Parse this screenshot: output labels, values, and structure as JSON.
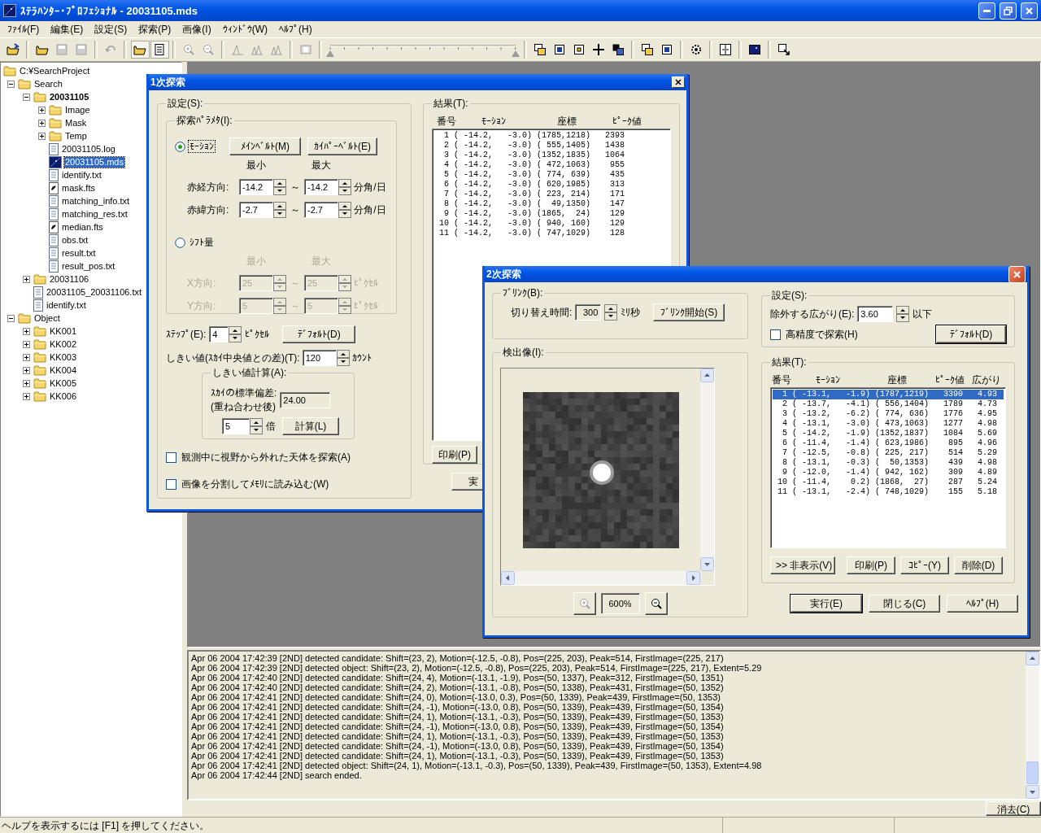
{
  "window": {
    "title": "ｽﾃﾗﾊﾝﾀｰ･ﾌﾟﾛﾌｪｼｮﾅﾙ - 20031105.mds"
  },
  "menu": [
    "ﾌｧｲﾙ(F)",
    "編集(E)",
    "設定(S)",
    "探索(P)",
    "画像(I)",
    "ｳｨﾝﾄﾞｳ(W)",
    "ﾍﾙﾌﾟ(H)"
  ],
  "toolbar": [
    {
      "kind": "open-project",
      "disabled": false,
      "pressed": false
    },
    {
      "kind": "separator"
    },
    {
      "kind": "open",
      "disabled": false,
      "pressed": false
    },
    {
      "kind": "save",
      "disabled": true,
      "pressed": false
    },
    {
      "kind": "save-all",
      "disabled": true,
      "pressed": false
    },
    {
      "kind": "separator"
    },
    {
      "kind": "undo",
      "disabled": true,
      "pressed": false
    },
    {
      "kind": "separator"
    },
    {
      "kind": "folder-view",
      "disabled": false,
      "pressed": true
    },
    {
      "kind": "document-view",
      "disabled": false,
      "pressed": true
    },
    {
      "kind": "separator"
    },
    {
      "kind": "zoom-in",
      "disabled": true,
      "pressed": false
    },
    {
      "kind": "zoom-out",
      "disabled": true,
      "pressed": false
    },
    {
      "kind": "separator"
    },
    {
      "kind": "peak",
      "disabled": true,
      "pressed": false
    },
    {
      "kind": "multi-peak",
      "disabled": true,
      "pressed": false
    },
    {
      "kind": "multi-peak",
      "disabled": true,
      "pressed": false
    },
    {
      "kind": "separator"
    },
    {
      "kind": "film",
      "disabled": true,
      "pressed": false
    },
    {
      "kind": "separator"
    },
    {
      "kind": "slider",
      "thumbs": [
        {
          "level": 0
        },
        {
          "level": 1
        }
      ]
    },
    {
      "kind": "separator"
    },
    {
      "kind": "windows",
      "disabled": false,
      "pressed": false
    },
    {
      "kind": "frame",
      "disabled": false,
      "pressed": false
    },
    {
      "kind": "target",
      "disabled": false,
      "pressed": false
    },
    {
      "kind": "crosshair",
      "disabled": false,
      "pressed": false
    },
    {
      "kind": "overlay",
      "disabled": false,
      "pressed": false
    },
    {
      "kind": "separator"
    },
    {
      "kind": "windows",
      "disabled": false,
      "pressed": false
    },
    {
      "kind": "frame",
      "disabled": false,
      "pressed": false
    },
    {
      "kind": "separator"
    },
    {
      "kind": "gear",
      "disabled": false,
      "pressed": false
    },
    {
      "kind": "separator"
    },
    {
      "kind": "split",
      "disabled": false,
      "pressed": false
    },
    {
      "kind": "separator"
    },
    {
      "kind": "picture",
      "disabled": false,
      "pressed": false
    },
    {
      "kind": "separator"
    },
    {
      "kind": "export",
      "disabled": false,
      "pressed": false
    }
  ],
  "tree": {
    "label": "C:¥SearchProject",
    "kind": "folder",
    "selected": false,
    "current": false,
    "children": [
      {
        "label": "Search",
        "kind": "folder",
        "expanded": true,
        "selected": false,
        "current": false,
        "children": [
          {
            "label": "20031105",
            "kind": "folder",
            "expanded": true,
            "selected": false,
            "current": true,
            "children": [
              {
                "label": "Image",
                "kind": "folder",
                "expanded": false,
                "selected": false,
                "current": false
              },
              {
                "label": "Mask",
                "kind": "folder",
                "expanded": false,
                "selected": false,
                "current": false
              },
              {
                "label": "Temp",
                "kind": "folder",
                "expanded": false,
                "selected": false,
                "current": false
              },
              {
                "label": "20031105.log",
                "kind": "text",
                "selected": false,
                "current": false
              },
              {
                "label": "20031105.mds",
                "kind": "project",
                "selected": true,
                "current": false
              },
              {
                "label": "identify.txt",
                "kind": "text",
                "selected": false,
                "current": false
              },
              {
                "label": "mask.fts",
                "kind": "image",
                "selected": false,
                "current": false
              },
              {
                "label": "matching_info.txt",
                "kind": "text",
                "selected": false,
                "current": false
              },
              {
                "label": "matching_res.txt",
                "kind": "text",
                "selected": false,
                "current": false
              },
              {
                "label": "median.fts",
                "kind": "image",
                "selected": false,
                "current": false
              },
              {
                "label": "obs.txt",
                "kind": "text",
                "selected": false,
                "current": false
              },
              {
                "label": "result.txt",
                "kind": "text",
                "selected": false,
                "current": false
              },
              {
                "label": "result_pos.txt",
                "kind": "text",
                "selected": false,
                "current": false
              }
            ]
          },
          {
            "label": "20031106",
            "kind": "folder",
            "expanded": false,
            "selected": false,
            "current": false
          },
          {
            "label": "20031105_20031106.txt",
            "kind": "text",
            "selected": false,
            "current": false
          },
          {
            "label": "identify.txt",
            "kind": "text",
            "selected": false,
            "current": false
          }
        ]
      },
      {
        "label": "Object",
        "kind": "folder",
        "expanded": true,
        "selected": false,
        "current": false,
        "children": [
          {
            "label": "KK001",
            "kind": "folder",
            "expanded": false,
            "selected": false,
            "current": false
          },
          {
            "label": "KK002",
            "kind": "folder",
            "expanded": false,
            "selected": false,
            "current": false
          },
          {
            "label": "KK003",
            "kind": "folder",
            "expanded": false,
            "selected": false,
            "current": false
          },
          {
            "label": "KK004",
            "kind": "folder",
            "expanded": false,
            "selected": false,
            "current": false
          },
          {
            "label": "KK005",
            "kind": "folder",
            "expanded": false,
            "selected": false,
            "current": false
          },
          {
            "label": "KK006",
            "kind": "folder",
            "expanded": false,
            "selected": false,
            "current": false
          }
        ]
      }
    ]
  },
  "search1": {
    "title": "1次探索",
    "settings_label": "設定(S):",
    "params_label": "探索ﾊﾟﾗﾒﾀ(I):",
    "motion": {
      "label": "ﾓｰｼｮﾝ",
      "selected": true,
      "buttons": [
        "ﾒｲﾝﾍﾞﾙﾄ(M)",
        "ｶｲﾊﾟｰﾍﾞﾙﾄ(E)"
      ],
      "min_label": "最小",
      "max_label": "最大",
      "rows": [
        {
          "label": "赤経方向:",
          "min": "-14.2",
          "sep": "～",
          "max": "-14.2",
          "unit": "分角/日"
        },
        {
          "label": "赤緯方向:",
          "min": "-2.7",
          "sep": "～",
          "max": "-2.7",
          "unit": "分角/日"
        }
      ]
    },
    "shift": {
      "label": "ｼﾌﾄ量",
      "selected": false,
      "min_label": "最小",
      "max_label": "最大",
      "rows": [
        {
          "label": "X方向:",
          "min": "25",
          "sep": "～",
          "max": "25",
          "unit": "ﾋﾟｸｾﾙ"
        },
        {
          "label": "Y方向:",
          "min": "5",
          "sep": "～",
          "max": "5",
          "unit": "ﾋﾟｸｾﾙ"
        }
      ]
    },
    "step": {
      "label": "ｽﾃｯﾌﾟ(E):",
      "value": "4",
      "unit": "ﾋﾟｸｾﾙ",
      "button": "ﾃﾞﾌｫﾙﾄ(D)"
    },
    "threshold": {
      "label": "しきい値(ｽｶｲ中央値との差)(T):",
      "value": "120",
      "unit": "ｶｳﾝﾄ"
    },
    "calc": {
      "label": "しきい値計算(A):",
      "sigma_label": "ｽｶｲの標準偏差:",
      "sigma_note": "(重ね合わせ後)",
      "sigma": "24.00",
      "factor": "5",
      "factor_unit": "倍",
      "button": "計算(L)"
    },
    "options": [
      {
        "label": "観測中に視野から外れた天体を探索(A)",
        "checked": false
      },
      {
        "label": "画像を分割してﾒﾓﾘに読み込む(W)",
        "checked": false
      }
    ],
    "results": {
      "label": "結果(T):",
      "columns": [
        "番号",
        "ﾓｰｼｮﾝ",
        "座標",
        "ﾋﾟｰｸ値"
      ],
      "rows": [
        "  1 ( -14.2,   -3.0) (1785,1218)   2393",
        "  2 ( -14.2,   -3.0) ( 555,1405)   1438",
        "  3 ( -14.2,   -3.0) (1352,1835)   1064",
        "  4 ( -14.2,   -3.0) ( 472,1063)    955",
        "  5 ( -14.2,   -3.0) ( 774, 639)    435",
        "  6 ( -14.2,   -3.0) ( 620,1985)    313",
        "  7 ( -14.2,   -3.0) ( 223, 214)    171",
        "  8 ( -14.2,   -3.0) (  49,1350)    147",
        "  9 ( -14.2,   -3.0) (1865,  24)    129",
        " 10 ( -14.2,   -3.0) ( 940, 160)    129",
        " 11 ( -14.2,   -3.0) ( 747,1029)    128"
      ]
    },
    "buttons": [
      "印刷(P)",
      "実"
    ]
  },
  "search2": {
    "title": "2次探索",
    "blink": {
      "label": "ﾌﾞﾘﾝｸ(B):",
      "time_label": "切り替え時間:",
      "time": "300",
      "unit": "ﾐﾘ秒",
      "button": "ﾌﾞﾘﾝｸ開始(S)"
    },
    "image": {
      "label": "検出像(I):",
      "zoom": "600%",
      "zoom_in": {
        "disabled": true
      },
      "zoom_out": {
        "disabled": false
      }
    },
    "settings": {
      "label": "設定(S):",
      "extent_label": "除外する広がり(E):",
      "extent": "3.60",
      "extent_unit": "以下",
      "precise": {
        "label": "高精度で探索(H)",
        "checked": false
      },
      "button": "ﾃﾞﾌｫﾙﾄ(D)"
    },
    "results": {
      "label": "結果(T):",
      "columns": [
        "番号",
        "ﾓｰｼｮﾝ",
        "座標",
        "ﾋﾟｰｸ値",
        "広がり"
      ],
      "rows": [
        {
          "text": "  1 ( -13.1,   -1.9) (1787,1219)   3390   4.93",
          "selected": true
        },
        {
          "text": "  2 ( -13.7,   -4.1) ( 556,1404)   1789   4.73",
          "selected": false
        },
        {
          "text": "  3 ( -13.2,   -6.2) ( 774, 636)   1776   4.95",
          "selected": false
        },
        {
          "text": "  4 ( -13.1,   -3.0) ( 473,1063)   1277   4.98",
          "selected": false
        },
        {
          "text": "  5 ( -14.2,   -1.9) (1352,1837)   1084   5.69",
          "selected": false
        },
        {
          "text": "  6 ( -11.4,   -1.4) ( 623,1986)    895   4.96",
          "selected": false
        },
        {
          "text": "  7 ( -12.5,   -0.8) ( 225, 217)    514   5.29",
          "selected": false
        },
        {
          "text": "  8 ( -13.1,   -0.3) (  50,1353)    439   4.98",
          "selected": false
        },
        {
          "text": "  9 ( -12.0,   -1.4) ( 942, 162)    309   4.89",
          "selected": false
        },
        {
          "text": " 10 ( -11.4,    0.2) (1868,  27)    287   5.24",
          "selected": false
        },
        {
          "text": " 11 ( -13.1,   -2.4) ( 748,1029)    155   5.18",
          "selected": false
        }
      ],
      "buttons": [
        ">> 非表示(V)",
        "印刷(P)",
        "ｺﾋﾟｰ(Y)",
        "削除(D)"
      ]
    },
    "buttons": [
      "実行(E)",
      "閉じる(C)",
      "ﾍﾙﾌﾟ(H)"
    ]
  },
  "log": {
    "lines": [
      "Apr 06 2004 17:42:39 [2ND] detected candidate: Shift=(23, 2), Motion=(-12.5, -0.8), Pos=(225, 203), Peak=514, FirstImage=(225, 217)",
      "Apr 06 2004 17:42:39 [2ND] detected object: Shift=(23, 2), Motion=(-12.5, -0.8), Pos=(225, 203), Peak=514, FirstImage=(225, 217), Extent=5.29",
      "Apr 06 2004 17:42:40 [2ND] detected candidate: Shift=(24, 4), Motion=(-13.1, -1.9), Pos=(50, 1337), Peak=312, FirstImage=(50, 1351)",
      "Apr 06 2004 17:42:40 [2ND] detected candidate: Shift=(24, 2), Motion=(-13.1, -0.8), Pos=(50, 1338), Peak=431, FirstImage=(50, 1352)",
      "Apr 06 2004 17:42:41 [2ND] detected candidate: Shift=(24, 0), Motion=(-13.0, 0.3), Pos=(50, 1339), Peak=439, FirstImage=(50, 1353)",
      "Apr 06 2004 17:42:41 [2ND] detected candidate: Shift=(24, -1), Motion=(-13.0, 0.8), Pos=(50, 1339), Peak=439, FirstImage=(50, 1354)",
      "Apr 06 2004 17:42:41 [2ND] detected candidate: Shift=(24, 1), Motion=(-13.1, -0.3), Pos=(50, 1339), Peak=439, FirstImage=(50, 1353)",
      "Apr 06 2004 17:42:41 [2ND] detected candidate: Shift=(24, -1), Motion=(-13.0, 0.8), Pos=(50, 1339), Peak=439, FirstImage=(50, 1354)",
      "Apr 06 2004 17:42:41 [2ND] detected candidate: Shift=(24, 1), Motion=(-13.1, -0.3), Pos=(50, 1339), Peak=439, FirstImage=(50, 1353)",
      "Apr 06 2004 17:42:41 [2ND] detected candidate: Shift=(24, -1), Motion=(-13.0, 0.8), Pos=(50, 1339), Peak=439, FirstImage=(50, 1354)",
      "Apr 06 2004 17:42:41 [2ND] detected candidate: Shift=(24, 1), Motion=(-13.1, -0.3), Pos=(50, 1339), Peak=439, FirstImage=(50, 1353)",
      "Apr 06 2004 17:42:41 [2ND] detected object: Shift=(24, 1), Motion=(-13.1, -0.3), Pos=(50, 1339), Peak=439, FirstImage=(50, 1353), Extent=4.98",
      "Apr 06 2004 17:42:44 [2ND] search ended."
    ],
    "clear_button": "消去(C)"
  },
  "status_bar": {
    "text": "ヘルプを表示するには [F1] を押してください。"
  }
}
